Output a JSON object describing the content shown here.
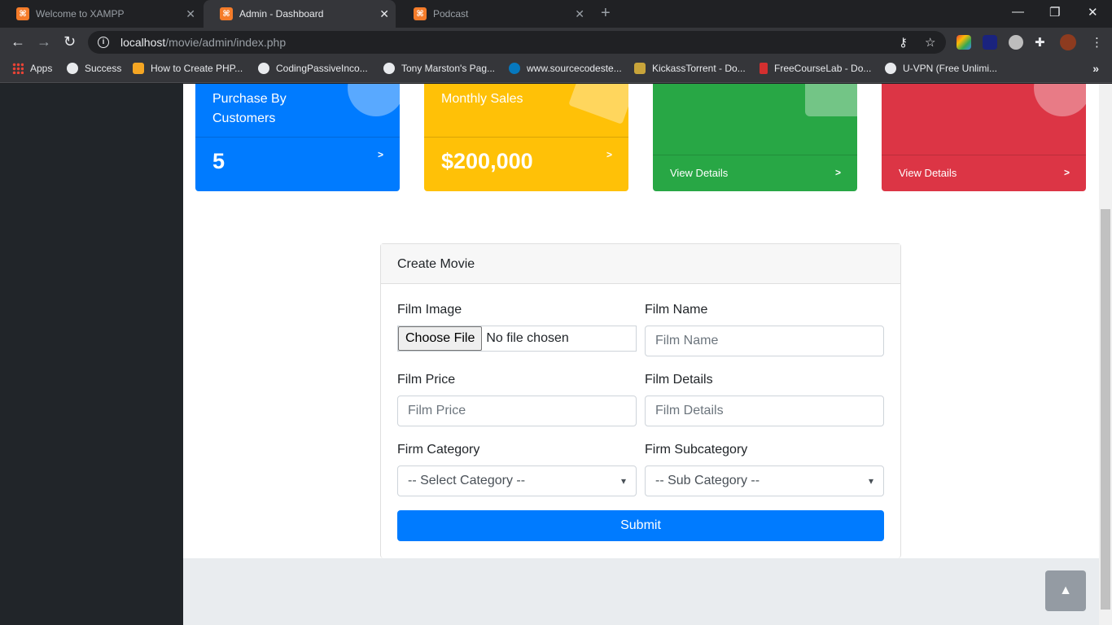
{
  "browser": {
    "tabs": [
      {
        "title": "Welcome to XAMPP",
        "active": false
      },
      {
        "title": "Admin - Dashboard",
        "active": true
      },
      {
        "title": "Podcast",
        "active": false
      }
    ],
    "url_host": "localhost",
    "url_path": "/movie/admin/index.php",
    "bookmarks": [
      {
        "label": "Apps",
        "icon": "apps-grid-icon"
      },
      {
        "label": "Success",
        "icon": "globe-icon"
      },
      {
        "label": "How to Create PHP...",
        "icon": "p-logo-icon"
      },
      {
        "label": "CodingPassiveInco...",
        "icon": "globe-icon"
      },
      {
        "label": "Tony Marston's Pag...",
        "icon": "globe-icon"
      },
      {
        "label": "www.sourcecodeste...",
        "icon": "drupal-icon"
      },
      {
        "label": "KickassTorrent - Do...",
        "icon": "kat-icon"
      },
      {
        "label": "FreeCourseLab - Do...",
        "icon": "book-icon"
      },
      {
        "label": "U-VPN (Free Unlimi...",
        "icon": "globe-icon"
      }
    ],
    "bookmarks_more": "»"
  },
  "cards": [
    {
      "title_line1": "Purchase By",
      "title_line2": "Customers",
      "value": "5",
      "color": "#007bff"
    },
    {
      "title_line1": "Monthly Sales",
      "title_line2": "",
      "value": "$200,000",
      "color": "#ffc107"
    },
    {
      "title_line1": "",
      "title_line2": "",
      "link": "View Details",
      "color": "#28a745"
    },
    {
      "title_line1": "",
      "title_line2": "",
      "link": "View Details",
      "color": "#dc3545"
    }
  ],
  "form": {
    "header": "Create Movie",
    "film_image_label": "Film Image",
    "choose_file": "Choose File",
    "no_file": "No file chosen",
    "film_name_label": "Film Name",
    "film_name_placeholder": "Film Name",
    "film_price_label": "Film Price",
    "film_price_placeholder": "Film Price",
    "film_details_label": "Film Details",
    "film_details_placeholder": "Film Details",
    "category_label": "Firm Category",
    "category_selected": "-- Select Category --",
    "subcategory_label": "Firm Subcategory",
    "subcategory_selected": "-- Sub Category --",
    "submit": "Submit"
  }
}
